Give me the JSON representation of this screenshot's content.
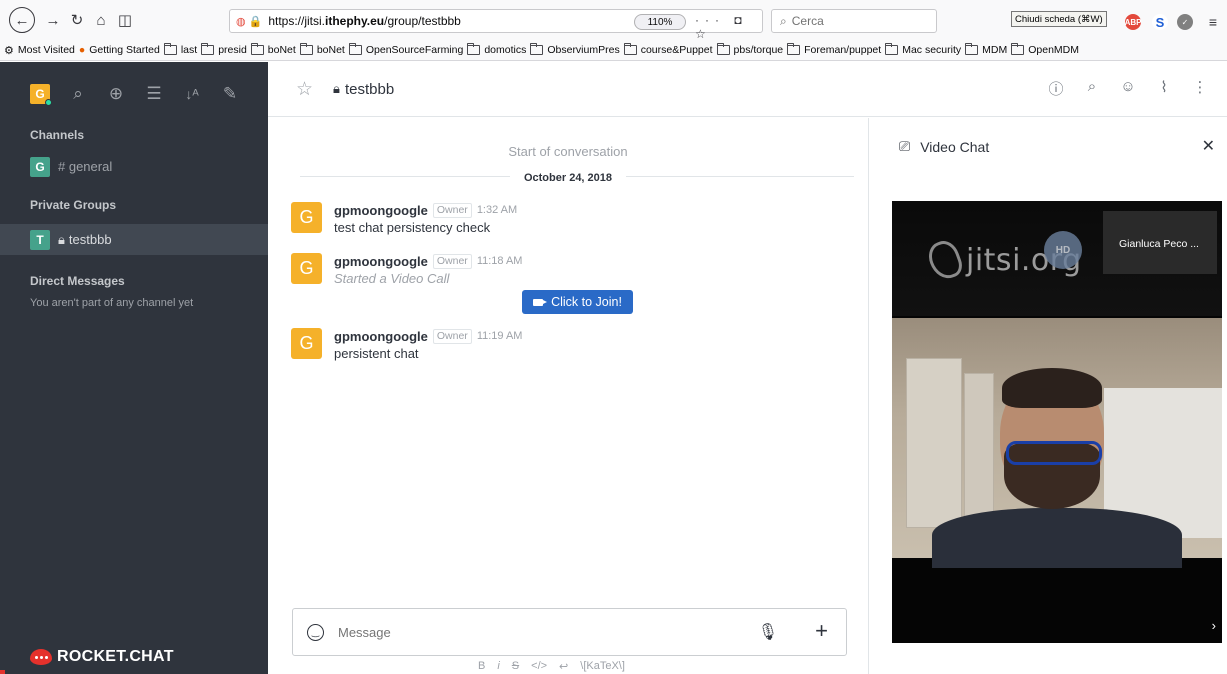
{
  "browser": {
    "url_prefix": "https://jitsi.",
    "url_host": "ithephy.eu",
    "url_path": "/group/testbbb",
    "zoom": "110%",
    "url_actions": "··· ◘ ☆",
    "search_placeholder": "Cerca",
    "tooltip": "Chiudi scheda (⌘W)",
    "bookmarks": [
      "Most Visited",
      "Getting Started",
      "last",
      "presid",
      "boNet",
      "boNet",
      "OpenSourceFarming",
      "domotics",
      "ObserviumPres",
      "course&Puppet",
      "pbs/torque",
      "Foreman/puppet",
      "Mac security",
      "MDM",
      "OpenMDM"
    ]
  },
  "sidebar": {
    "avatar_letter": "G",
    "sections": {
      "channels": "Channels",
      "private_groups": "Private Groups",
      "direct_messages": "Direct Messages"
    },
    "channel": {
      "avatar": "G",
      "label": "# general"
    },
    "group": {
      "avatar": "T",
      "label": "testbbb"
    },
    "dm_note": "You aren't part of any channel yet",
    "logo_text": "ROCKET.CHAT"
  },
  "room": {
    "title": "testbbb"
  },
  "conversation": {
    "start_label": "Start of conversation",
    "date": "October 24, 2018",
    "messages": [
      {
        "avatar": "G",
        "user": "gpmoongoogle",
        "role": "Owner",
        "time": "1:32 AM",
        "text": "test chat persistency check"
      },
      {
        "avatar": "G",
        "user": "gpmoongoogle",
        "role": "Owner",
        "time": "11:18 AM",
        "text": "Started a Video Call"
      },
      {
        "avatar": "G",
        "user": "gpmoongoogle",
        "role": "Owner",
        "time": "11:19 AM",
        "text": "persistent chat"
      }
    ],
    "join_label": "Click to Join!"
  },
  "composer": {
    "placeholder": "Message",
    "format_items": [
      "B",
      "i",
      "S",
      "</>",
      "↩",
      "\\[KaTeX\\]"
    ]
  },
  "video_chat": {
    "title": "Video Chat",
    "logo": "jitsi.org",
    "hd_badge": "HD",
    "thumb_name": "Gianluca Peco ..."
  },
  "icons": {
    "sidebar_tools": [
      "search-icon",
      "globe-icon",
      "list-icon",
      "sort-icon",
      "edit-icon"
    ],
    "header_tools": [
      "info-icon",
      "search-icon",
      "members-icon",
      "attachment-icon",
      "kebab-icon"
    ]
  },
  "colors": {
    "sidebar_bg": "#2f343d",
    "avatar_yellow": "#f5b12a",
    "room_avatar_green": "#45a28b",
    "join_button": "#2a6ac7",
    "logo_red": "#e5312c"
  }
}
